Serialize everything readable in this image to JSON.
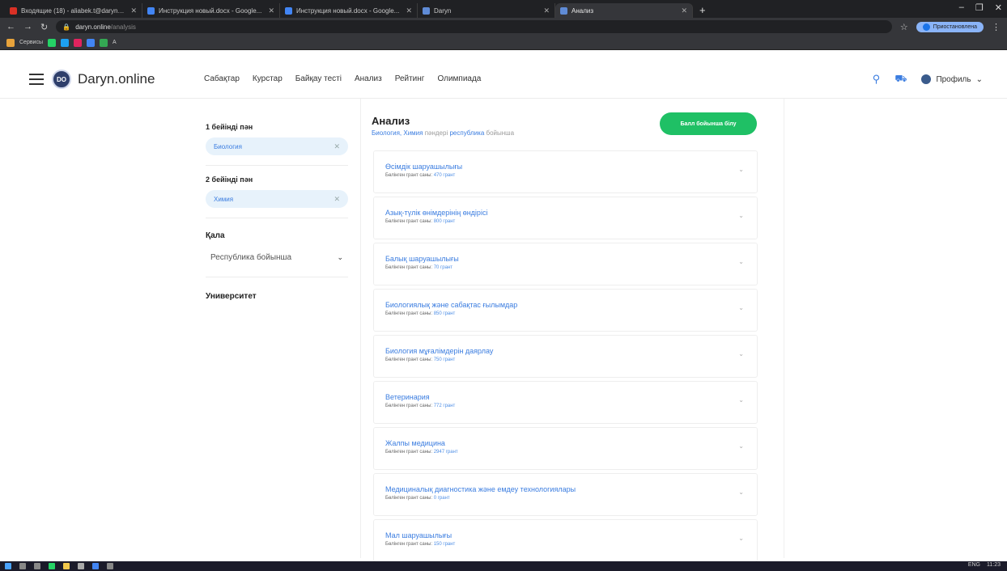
{
  "browser": {
    "tabs": [
      {
        "title": "Входящие (18) - aliabek.t@daryn.online - ...",
        "favicon_color": "#d93025",
        "active": false
      },
      {
        "title": "Инструкция новый.docx - Google...",
        "favicon_color": "#4285f4",
        "active": false
      },
      {
        "title": "Инструкция новый.docx - Google...",
        "favicon_color": "#4285f4",
        "active": false
      },
      {
        "title": "Daryn",
        "favicon_color": "#5f8bd6",
        "active": false
      },
      {
        "title": "Анализ",
        "favicon_color": "#5f8bd6",
        "active": true
      }
    ],
    "url_host": "daryn.online",
    "url_path": "/analysis",
    "profile_button": "Приостановлена",
    "bookmarks": [
      {
        "label": "Сервисы",
        "color": "#e8a33b"
      },
      {
        "label": "",
        "color": "#25d366"
      },
      {
        "label": "",
        "color": "#1da1f2"
      },
      {
        "label": "",
        "color": "#e0245e"
      },
      {
        "label": "",
        "color": "#4285f4"
      },
      {
        "label": "A",
        "color": "#34a853"
      }
    ]
  },
  "header": {
    "logo_mark": "DO",
    "logo_text": "Daryn.online",
    "nav": [
      "Сабақтар",
      "Курстар",
      "Байқау тесті",
      "Анализ",
      "Рейтинг",
      "Олимпиада"
    ],
    "profile_label": "Профиль"
  },
  "filters": {
    "subject1_label": "1 бейінді пән",
    "subject1_value": "Биология",
    "subject2_label": "2 бейінді пән",
    "subject2_value": "Химия",
    "city_label": "Қала",
    "city_value": "Республика бойынша",
    "university_label": "Университет"
  },
  "main": {
    "title": "Анализ",
    "subtitle_subjects": "Биология, Химия",
    "subtitle_middle": " пәндері ",
    "subtitle_region": "республика",
    "subtitle_end": " бойынша",
    "cta_label": "Балл бойынша білу"
  },
  "specialties": [
    {
      "name": "Өсімдік шаруашылығы",
      "meta": "Бөлінген грант саны:",
      "grant": "470 грант"
    },
    {
      "name": "Азық-түлік өнімдерінің өндірісі",
      "meta": "Бөлінген грант саны:",
      "grant": "800 грант"
    },
    {
      "name": "Балық шаруашылығы",
      "meta": "Бөлінген грант саны:",
      "grant": "70 грант"
    },
    {
      "name": "Биологиялық және сабақтас ғылымдар",
      "meta": "Бөлінген грант саны:",
      "grant": "850 грант"
    },
    {
      "name": "Биология мұғалімдерін даярлау",
      "meta": "Бөлінген грант саны:",
      "grant": "750 грант"
    },
    {
      "name": "Ветеринария",
      "meta": "Бөлінген грант саны:",
      "grant": "772 грант"
    },
    {
      "name": "Жалпы медицина",
      "meta": "Бөлінген грант саны:",
      "grant": "2947 грант"
    },
    {
      "name": "Медициналық диагностика және емдеу технологиялары",
      "meta": "Бөлінген грант саны:",
      "grant": "0 грант"
    },
    {
      "name": "Мал шаруашылығы",
      "meta": "Бөлінген грант саны:",
      "grant": "150 грант"
    }
  ],
  "taskbar": {
    "tray": [
      "ENG",
      "11:23"
    ]
  }
}
